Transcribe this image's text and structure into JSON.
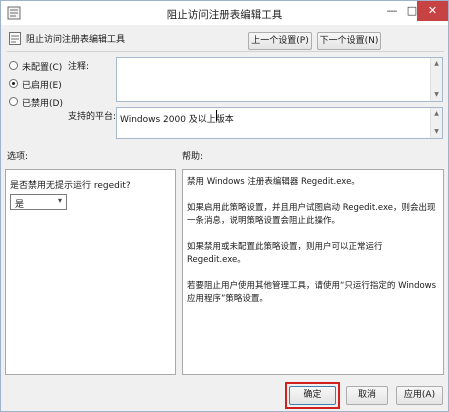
{
  "window": {
    "title": "阻止访问注册表编辑工具",
    "minimize": "—",
    "maximize": "□",
    "close": "✕"
  },
  "policy_name": "阻止访问注册表编辑工具",
  "nav": {
    "prev_setting": "上一个设置(P)",
    "next_setting": "下一个设置(N)"
  },
  "state": {
    "options": [
      {
        "label": "未配置(C)",
        "selected": false
      },
      {
        "label": "已启用(E)",
        "selected": true
      },
      {
        "label": "已禁用(D)",
        "selected": false
      }
    ]
  },
  "comment": {
    "label": "注释:",
    "value": ""
  },
  "supported": {
    "label": "支持的平台:",
    "value": "Windows 2000 及以上版本"
  },
  "options_section": {
    "label": "选项:",
    "question": "是否禁用无提示运行 regedit?",
    "select_value": "是"
  },
  "help_section": {
    "label": "帮助:",
    "paragraphs": [
      "禁用 Windows 注册表编辑器 Regedit.exe。",
      "如果启用此策略设置，并且用户试图启动 Regedit.exe，则会出现一条消息，说明策略设置会阻止此操作。",
      "如果禁用或未配置此策略设置，则用户可以正常运行 Regedit.exe。",
      "若要阻止用户使用其他管理工具，请使用“只运行指定的 Windows 应用程序”策略设置。"
    ]
  },
  "buttons": {
    "ok": "确定",
    "cancel": "取消",
    "apply": "应用(A)"
  },
  "colors": {
    "highlight": "#d12020",
    "close_button": "#c74343"
  }
}
